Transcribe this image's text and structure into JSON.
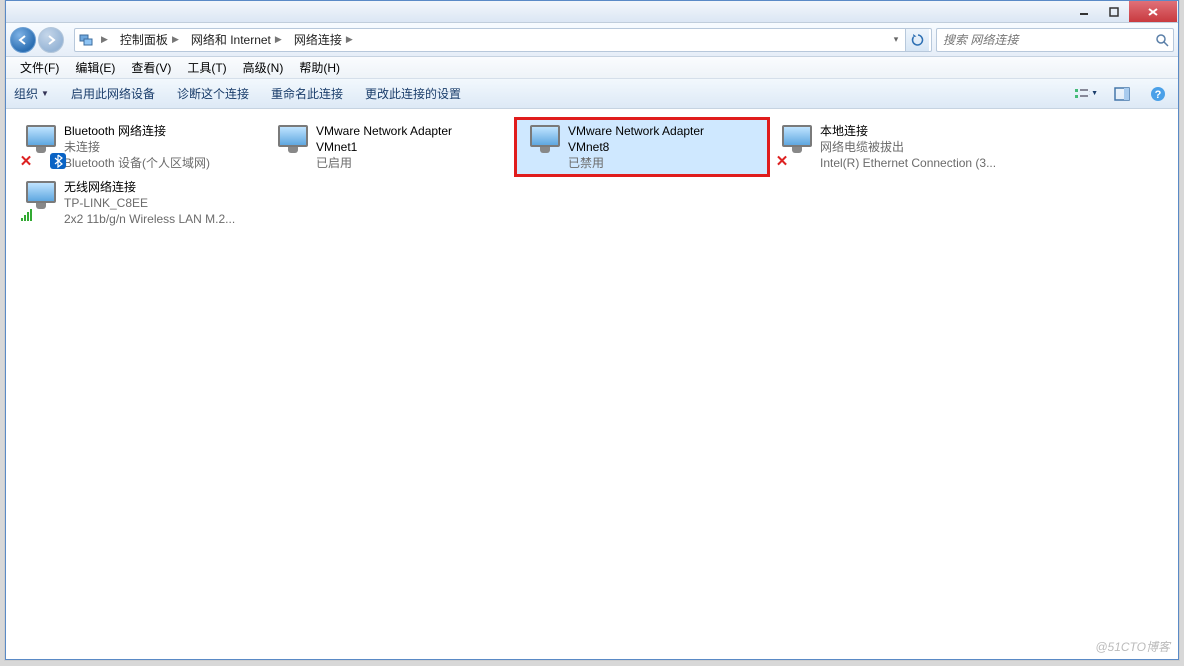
{
  "titlebar": {},
  "navbar": {
    "breadcrumb": [
      "控制面板",
      "网络和 Internet",
      "网络连接"
    ],
    "search_placeholder": "搜索 网络连接"
  },
  "menubar": [
    "文件(F)",
    "编辑(E)",
    "查看(V)",
    "工具(T)",
    "高级(N)",
    "帮助(H)"
  ],
  "cmdbar": {
    "organize": "组织",
    "actions": [
      "启用此网络设备",
      "诊断这个连接",
      "重命名此连接",
      "更改此连接的设置"
    ]
  },
  "connections": [
    {
      "name": "Bluetooth 网络连接",
      "status": "未连接",
      "device": "Bluetooth 设备(个人区域网)",
      "overlay": "x",
      "extra": "bt"
    },
    {
      "name": "VMware Network Adapter VMnet1",
      "status": "已启用",
      "device": ""
    },
    {
      "name": "VMware Network Adapter VMnet8",
      "status": "已禁用",
      "device": "",
      "selected": true,
      "highlight": true
    },
    {
      "name": "本地连接",
      "status": "网络电缆被拔出",
      "device": "Intel(R) Ethernet Connection (3...",
      "overlay": "x"
    },
    {
      "name": "无线网络连接",
      "status": "TP-LINK_C8EE",
      "device": "2x2 11b/g/n Wireless LAN M.2...",
      "overlay": "bars"
    }
  ],
  "watermark": "@51CTO博客"
}
